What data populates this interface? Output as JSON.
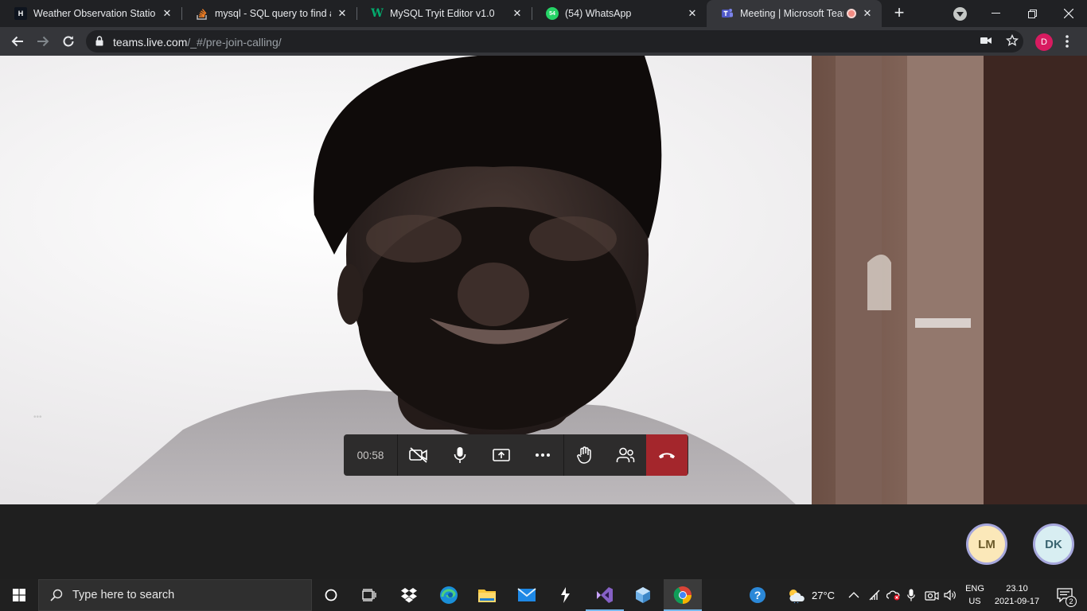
{
  "browser": {
    "tabs": [
      {
        "title": "Weather Observation Station",
        "icon": "hackerrank-icon"
      },
      {
        "title": "mysql - SQL query to find a li",
        "icon": "stackoverflow-icon"
      },
      {
        "title": "MySQL Tryit Editor v1.0",
        "icon": "w3schools-icon"
      },
      {
        "title": "(54) WhatsApp",
        "icon": "whatsapp-icon",
        "badge": "54"
      },
      {
        "title": "Meeting | Microsoft Team",
        "icon": "teams-icon",
        "active": true,
        "recording": true
      }
    ],
    "url_host": "teams.live.com",
    "url_path": "/_#/pre-join-calling/",
    "profile_initial": "D",
    "profile_color": "#d81b60"
  },
  "meeting": {
    "elapsed": "00:58",
    "controls": [
      "camera-off-icon",
      "microphone-icon",
      "share-screen-icon",
      "more-options-icon",
      "raise-hand-icon",
      "participants-icon",
      "hang-up-icon"
    ],
    "more_label": "...",
    "hangup_color": "#a4262c",
    "participants": [
      {
        "initials": "LM",
        "bg": "#fbe8b9",
        "fg": "#6b5a2a"
      },
      {
        "initials": "DK",
        "bg": "#d8eef2",
        "fg": "#3a6470"
      }
    ]
  },
  "taskbar": {
    "search_placeholder": "Type here to search",
    "temperature": "27°C",
    "language": "ENG",
    "region": "US",
    "time": "23.10",
    "date": "2021-09-17",
    "notification_count": "2"
  }
}
